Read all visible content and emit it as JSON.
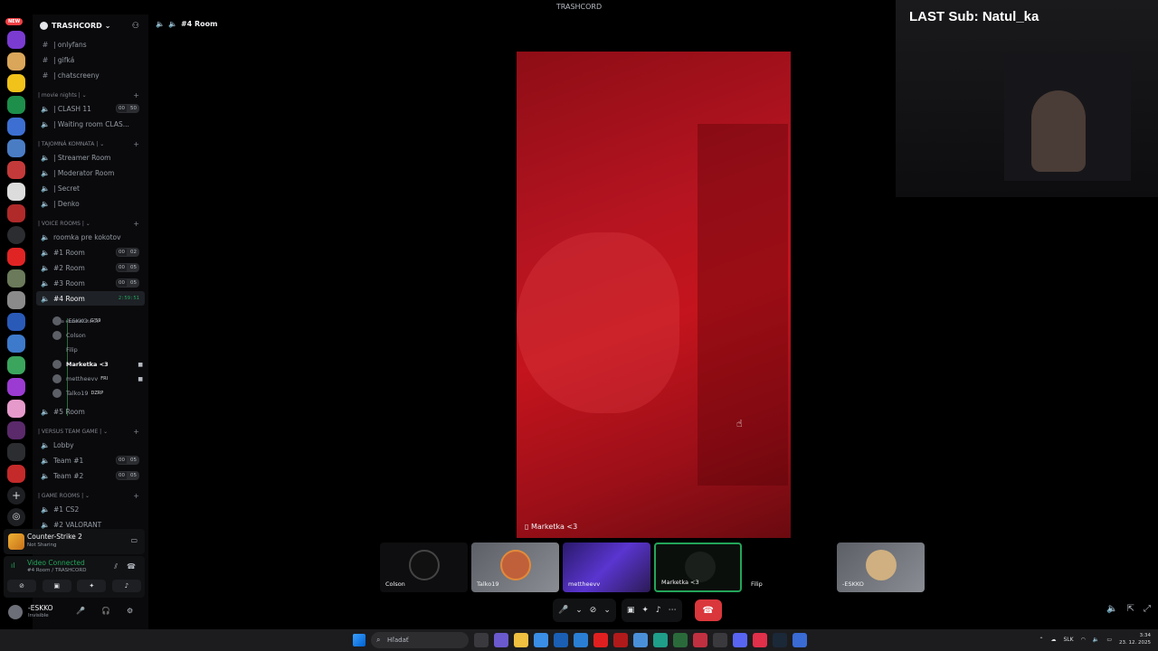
{
  "window": {
    "title": "TRASHCORD"
  },
  "rail": {
    "new_badge": "NEW"
  },
  "guild": {
    "name": "TRASHCORD",
    "channels_top": [
      {
        "icon": "#",
        "label": "| onlyfans"
      },
      {
        "icon": "#",
        "label": "| gifká"
      },
      {
        "icon": "#",
        "label": "| chatscreeny"
      }
    ],
    "categories": {
      "movie": "| movie nights |",
      "tajomna": "| TAJOMNÁ KOMNATA |",
      "voice": "| VOICE ROOMS |",
      "versus": "| VERSUS TEAM GAME |",
      "game": "| GAME ROOMS |"
    },
    "movie_channels": [
      {
        "label": "| CLASH 11",
        "count_a": "00",
        "count_b": "50"
      },
      {
        "label": "| Waiting room CLAS..."
      }
    ],
    "tajomna_channels": [
      {
        "label": "| Streamer Room"
      },
      {
        "label": "| Moderator Room"
      },
      {
        "label": "| Secret"
      },
      {
        "label": "| Denko"
      }
    ],
    "voice_channels": [
      {
        "label": "roomka pre kokotov"
      },
      {
        "label": "#1 Room",
        "count_a": "00",
        "count_b": "02"
      },
      {
        "label": "#2 Room",
        "count_a": "00",
        "count_b": "05"
      },
      {
        "label": "#3 Room",
        "count_a": "00",
        "count_b": "05"
      }
    ],
    "active_room": {
      "label": "#4 Room",
      "timer": "2:59:51",
      "status": "Set a channel status"
    },
    "members": [
      {
        "name": "-ESKKO",
        "tag": "G'59"
      },
      {
        "name": "Colson",
        "tag": ""
      },
      {
        "name": "Filip",
        "tag": ""
      },
      {
        "name": "Marketka <3",
        "tag": ""
      },
      {
        "name": "mettheevv",
        "tag": "FRI"
      },
      {
        "name": "Talko19",
        "tag": "DZRP"
      }
    ],
    "room5": "#5 Room",
    "versus_channels": [
      {
        "label": "Lobby"
      },
      {
        "label": "Team #1",
        "count_a": "00",
        "count_b": "05"
      },
      {
        "label": "Team #2",
        "count_a": "00",
        "count_b": "05"
      }
    ],
    "game_channels": [
      {
        "label": "#1 CS2"
      },
      {
        "label": "#2 VALORANT"
      }
    ]
  },
  "activity": {
    "game": "Counter-Strike 2",
    "status": "Not Sharing"
  },
  "voice": {
    "status": "Video Connected",
    "location": "#4 Room / TRASHCORD"
  },
  "user": {
    "name": "-ESKKO",
    "status": "Invisible"
  },
  "main": {
    "channel": "#4 Room",
    "stage_label": "Marketka <3",
    "tiles": [
      {
        "name": "Colson"
      },
      {
        "name": "Talko19"
      },
      {
        "name": "mettheevv"
      },
      {
        "name": "Marketka <3"
      },
      {
        "name": "Filip"
      },
      {
        "name": "-ESKKO"
      }
    ]
  },
  "overlay": {
    "sub": "LAST Sub: Natul_ka"
  },
  "taskbar": {
    "search": "Hľadať",
    "lang": "SLK",
    "time": "3:34",
    "date": "23. 12. 2025"
  }
}
